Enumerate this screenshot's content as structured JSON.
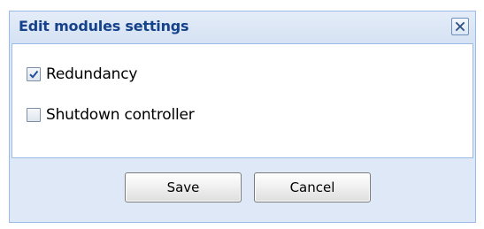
{
  "dialog": {
    "title": "Edit modules settings",
    "close_icon": "close-icon"
  },
  "options": [
    {
      "label": "Redundancy",
      "checked": true
    },
    {
      "label": "Shutdown controller",
      "checked": false
    }
  ],
  "buttons": {
    "save_label": "Save",
    "cancel_label": "Cancel"
  },
  "colors": {
    "title_text": "#15428b",
    "dialog_background": "#dfe8f6",
    "border": "#99bbe8",
    "checkmark": "#1f4e9a"
  }
}
